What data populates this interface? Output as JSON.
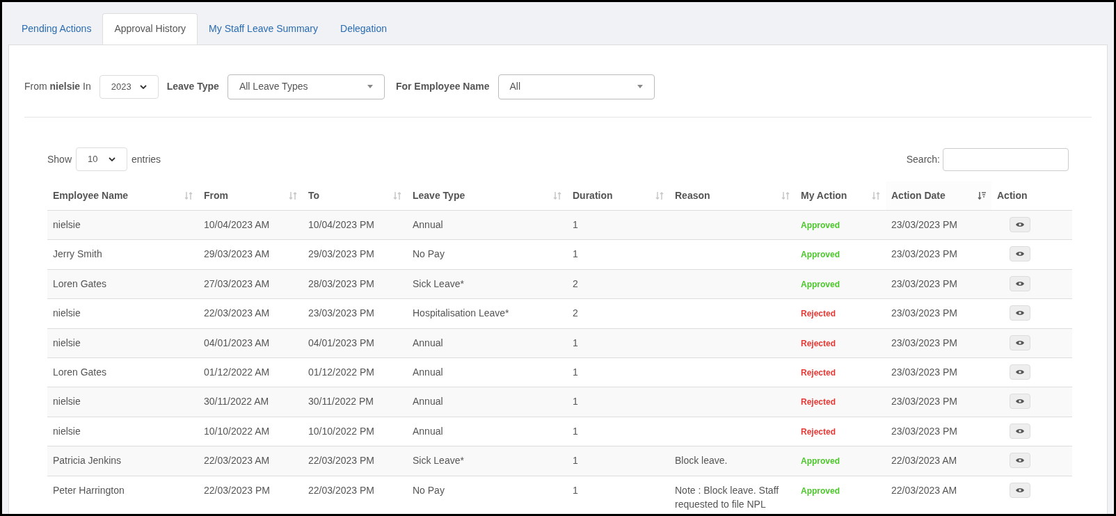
{
  "tabs": [
    {
      "label": "Pending Actions",
      "selected": false
    },
    {
      "label": "Approval History",
      "selected": true
    },
    {
      "label": "My Staff Leave Summary",
      "selected": false
    },
    {
      "label": "Delegation",
      "selected": false
    }
  ],
  "filters": {
    "from_label": "From",
    "from_name": "nielsie",
    "in_label": "In",
    "year": "2023",
    "leave_type_label": "Leave Type",
    "leave_type": "All Leave Types",
    "employee_label": "For Employee Name",
    "employee": "All"
  },
  "length": {
    "show": "Show",
    "value": "10",
    "entries": "entries"
  },
  "search": {
    "label": "Search:"
  },
  "table": {
    "columns": [
      {
        "label": "Employee Name",
        "kind": "sortable",
        "sorted": false
      },
      {
        "label": "From",
        "kind": "sortable",
        "sorted": false
      },
      {
        "label": "To",
        "kind": "sortable",
        "sorted": false
      },
      {
        "label": "Leave Type",
        "kind": "sortable",
        "sorted": false
      },
      {
        "label": "Duration",
        "kind": "sortable",
        "sorted": false
      },
      {
        "label": "Reason",
        "kind": "sortable",
        "sorted": false
      },
      {
        "label": "My Action",
        "kind": "sortable",
        "sorted": false
      },
      {
        "label": "Action Date",
        "kind": "sortable",
        "sorted": true
      },
      {
        "label": "Action",
        "kind": "plain"
      }
    ],
    "rows": [
      {
        "employee": "nielsie",
        "from": "10/04/2023 AM",
        "to": "10/04/2023 PM",
        "leave_type": "Annual",
        "duration": "1",
        "reason": "",
        "my_action": "Approved",
        "color": "#4cc72b",
        "action_date": "23/03/2023 PM"
      },
      {
        "employee": "Jerry Smith",
        "from": "29/03/2023 AM",
        "to": "29/03/2023 PM",
        "leave_type": "No Pay",
        "duration": "1",
        "reason": "",
        "my_action": "Approved",
        "color": "#4cc72b",
        "action_date": "23/03/2023 PM"
      },
      {
        "employee": "Loren Gates",
        "from": "27/03/2023 AM",
        "to": "28/03/2023 PM",
        "leave_type": "Sick Leave*",
        "duration": "2",
        "reason": "",
        "my_action": "Approved",
        "color": "#4cc72b",
        "action_date": "23/03/2023 PM"
      },
      {
        "employee": "nielsie",
        "from": "22/03/2023 AM",
        "to": "23/03/2023 PM",
        "leave_type": "Hospitalisation Leave*",
        "duration": "2",
        "reason": "",
        "my_action": "Rejected",
        "color": "#e53935",
        "action_date": "23/03/2023 PM"
      },
      {
        "employee": "nielsie",
        "from": "04/01/2023 AM",
        "to": "04/01/2023 PM",
        "leave_type": "Annual",
        "duration": "1",
        "reason": "",
        "my_action": "Rejected",
        "color": "#e53935",
        "action_date": "23/03/2023 PM"
      },
      {
        "employee": "Loren Gates",
        "from": "01/12/2022 AM",
        "to": "01/12/2022 PM",
        "leave_type": "Annual",
        "duration": "1",
        "reason": "",
        "my_action": "Rejected",
        "color": "#e53935",
        "action_date": "23/03/2023 PM"
      },
      {
        "employee": "nielsie",
        "from": "30/11/2022 AM",
        "to": "30/11/2022 PM",
        "leave_type": "Annual",
        "duration": "1",
        "reason": "",
        "my_action": "Rejected",
        "color": "#e53935",
        "action_date": "23/03/2023 PM"
      },
      {
        "employee": "nielsie",
        "from": "10/10/2022 AM",
        "to": "10/10/2022 PM",
        "leave_type": "Annual",
        "duration": "1",
        "reason": "",
        "my_action": "Rejected",
        "color": "#e53935",
        "action_date": "23/03/2023 PM"
      },
      {
        "employee": "Patricia Jenkins",
        "from": "22/03/2023 AM",
        "to": "22/03/2023 PM",
        "leave_type": "Sick Leave*",
        "duration": "1",
        "reason": "Block leave.",
        "my_action": "Approved",
        "color": "#4cc72b",
        "action_date": "22/03/2023 AM"
      },
      {
        "employee": "Peter Harrington",
        "from": "22/03/2023 PM",
        "to": "22/03/2023 PM",
        "leave_type": "No Pay",
        "duration": "1",
        "reason": "Note : Block leave. Staff requested to file NPL",
        "my_action": "Approved",
        "color": "#4cc72b",
        "action_date": "22/03/2023 AM"
      }
    ]
  }
}
